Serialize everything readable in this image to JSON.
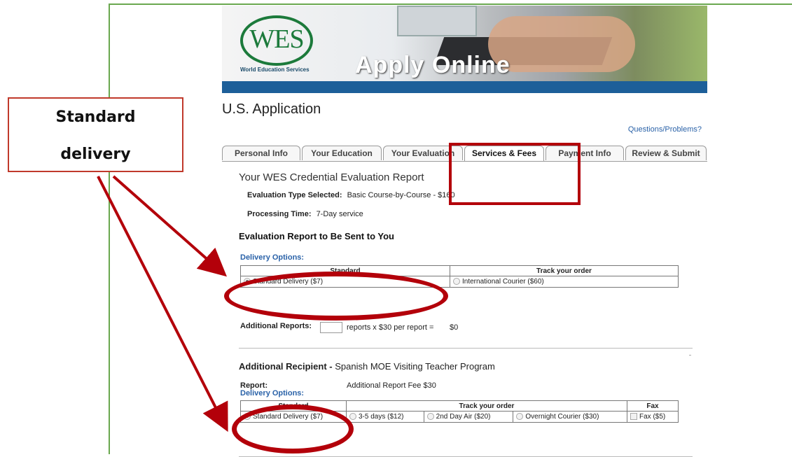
{
  "banner": {
    "logo_text": "WES",
    "logo_sub": "World Education Services",
    "apply_text": "Apply Online"
  },
  "page_title": "U.S. Application",
  "help_link": "Questions/Problems?",
  "tabs": [
    {
      "label": "Personal Info"
    },
    {
      "label": "Your Education"
    },
    {
      "label": "Your Evaluation"
    },
    {
      "label": "Services & Fees",
      "active": true
    },
    {
      "label": "Payment Info"
    },
    {
      "label": "Review & Submit"
    }
  ],
  "evaluation": {
    "title": "Your WES Credential Evaluation Report",
    "type_label": "Evaluation Type Selected:",
    "type_value": "Basic Course-by-Course - $160",
    "time_label": "Processing Time:",
    "time_value": "7-Day service"
  },
  "report_to_you": {
    "heading": "Evaluation Report to Be Sent to You",
    "delivery_label": "Delivery Options:",
    "col_standard": "Standard",
    "col_track": "Track your order",
    "opt_standard": "Standard Delivery ($7)",
    "opt_courier": "International Courier ($60)",
    "additional_label": "Additional Reports:",
    "additional_mid": "reports x $30 per report =",
    "additional_total": "$0"
  },
  "recipient": {
    "label": "Additional Recipient -",
    "name": "Spanish MOE Visiting Teacher Program",
    "report_label": "Report:",
    "report_value": "Additional Report Fee $30",
    "delivery_label": "Delivery Options:",
    "col_standard": "Standard",
    "col_track": "Track your order",
    "col_fax": "Fax",
    "opt_standard": "Standard Delivery ($7)",
    "opt_3to5": "3-5 days ($12)",
    "opt_2day": "2nd Day Air ($20)",
    "opt_overnight": "Overnight Courier ($30)",
    "opt_fax": "Fax ($5)"
  },
  "annotation": {
    "callout_line1": "Standard",
    "callout_line2": "delivery",
    "color": "#b3000a"
  }
}
